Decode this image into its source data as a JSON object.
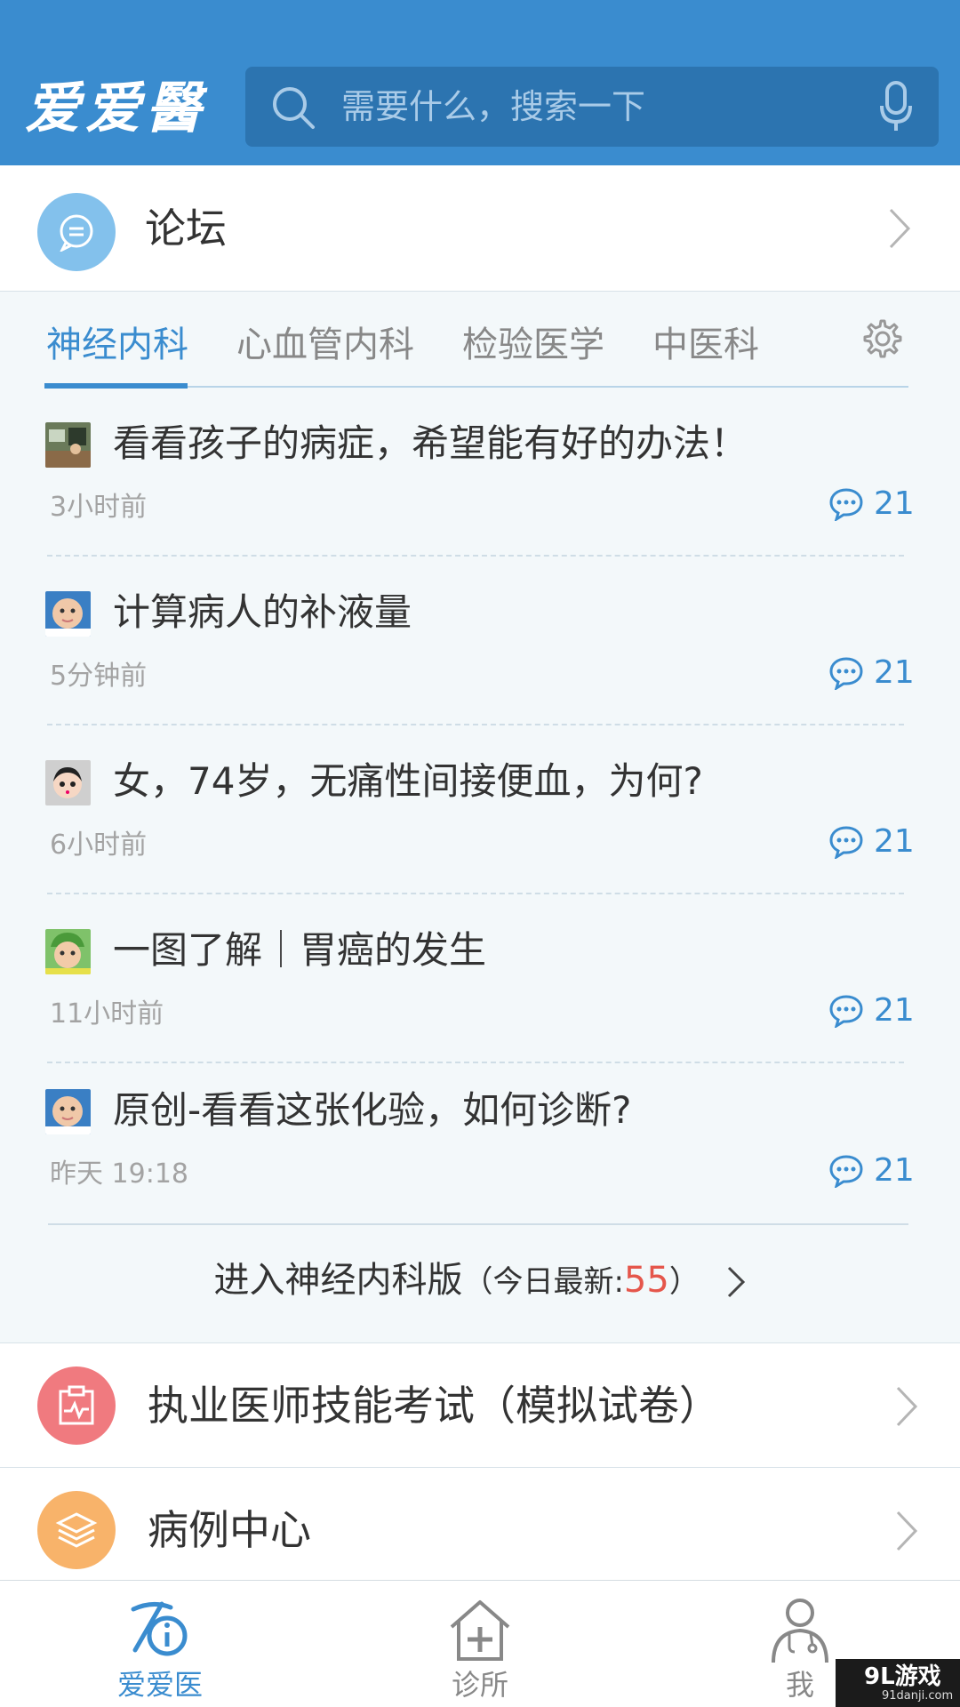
{
  "header": {
    "logo": "爱爱醫",
    "search_placeholder": "需要什么，搜索一下"
  },
  "forum": {
    "label": "论坛"
  },
  "tabs": [
    {
      "label": "神经内科",
      "active": true
    },
    {
      "label": "心血管内科"
    },
    {
      "label": "检验医学"
    },
    {
      "label": "中医科"
    }
  ],
  "posts": [
    {
      "title": "看看孩子的病症，希望能有好的办法！",
      "time": "3小时前",
      "comments": "21"
    },
    {
      "title": "计算病人的补液量",
      "time": "5分钟前",
      "comments": "21"
    },
    {
      "title": "女，74岁，无痛性间接便血，为何?",
      "time": "6小时前",
      "comments": "21"
    },
    {
      "title": "一图了解｜胃癌的发生",
      "time": "11小时前",
      "comments": "21"
    },
    {
      "title": "原创-看看这张化验，如何诊断?",
      "time": "昨天 19:18",
      "comments": "21"
    }
  ],
  "enter": {
    "label": "进入神经内科版",
    "paren_open": "（今日最新:",
    "new_count": "55",
    "paren_close": "）"
  },
  "menu": [
    {
      "label": "执业医师技能考试（模拟试卷）",
      "icon": "clipboard-icon",
      "color": "#f07a7f"
    },
    {
      "label": "病例中心",
      "icon": "layers-icon",
      "color": "#f8b36a"
    }
  ],
  "nav": [
    {
      "label": "爱爱医",
      "active": true
    },
    {
      "label": "诊所"
    },
    {
      "label": "我"
    }
  ],
  "watermark": {
    "main": "9L游戏",
    "sub": "91danji.com"
  },
  "colors": {
    "primary": "#3a8ccf",
    "accent_red": "#e5564b"
  }
}
